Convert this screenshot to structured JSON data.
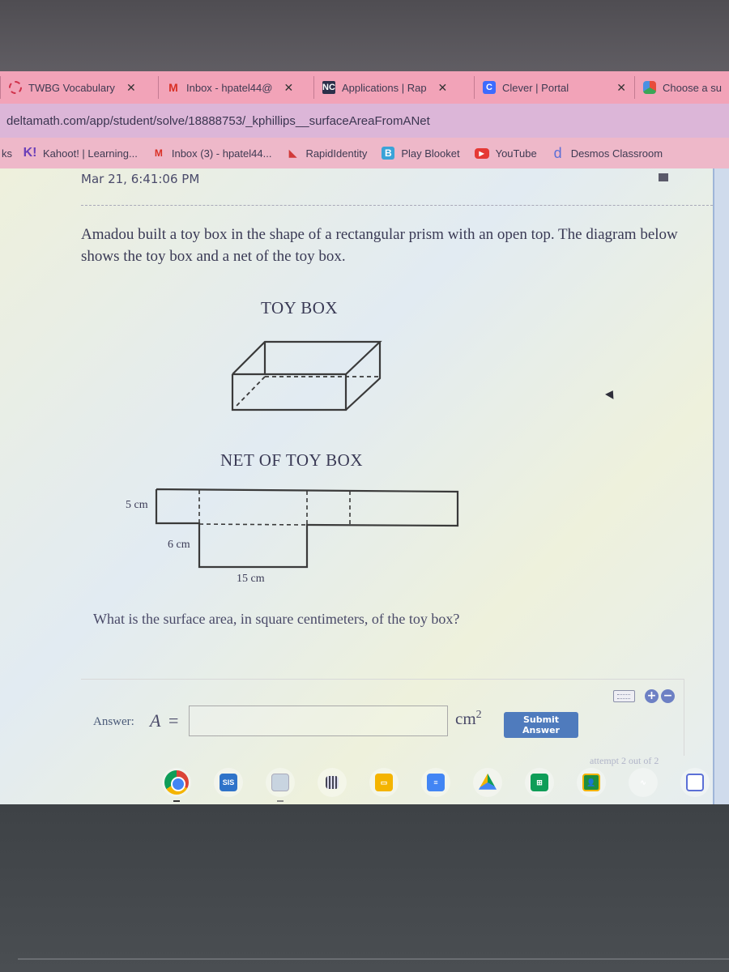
{
  "browser": {
    "tabs": [
      {
        "title": "TWBG Vocabulary",
        "icon": "loading-ring-icon",
        "closable": true
      },
      {
        "title": "Inbox - hpatel44@",
        "icon": "gmail-icon",
        "closable": true
      },
      {
        "title": "Applications | Rap",
        "icon": "nc-icon",
        "icon_text": "NC",
        "closable": true
      },
      {
        "title": "Clever | Portal",
        "icon": "clever-icon",
        "icon_text": "C",
        "closable": true
      },
      {
        "title": "Choose a su",
        "icon": "cube-icon",
        "closable": false
      }
    ],
    "url": "deltamath.com/app/student/solve/18888753/_kphillips__surfaceAreaFromANet",
    "bookmarks_prefix": "ks",
    "bookmarks": [
      {
        "label": "Kahoot! | Learning...",
        "icon": "kahoot-icon",
        "icon_text": "K!"
      },
      {
        "label": "Inbox (3) - hpatel44...",
        "icon": "gmail-icon",
        "icon_text": "M"
      },
      {
        "label": "RapidIdentity",
        "icon": "rapididentity-icon",
        "icon_text": "◣"
      },
      {
        "label": "Play Blooket",
        "icon": "blooket-icon",
        "icon_text": "B"
      },
      {
        "label": "YouTube",
        "icon": "youtube-icon",
        "icon_text": "▶"
      },
      {
        "label": "Desmos Classroom",
        "icon": "desmos-icon",
        "icon_text": "d"
      }
    ]
  },
  "page": {
    "timestamp": "Mar 21, 6:41:06 PM",
    "problem_text": "Amadou built a toy box in the shape of a rectangular prism with an open top. The diagram below shows the toy box and a net of the toy box.",
    "figure_title_box": "TOY BOX",
    "figure_title_net": "NET OF TOY BOX",
    "dimensions": {
      "height": "5 cm",
      "width": "6 cm",
      "length": "15 cm"
    },
    "question": "What is the surface area, in square centimeters, of the toy box?",
    "answer": {
      "label": "Answer:",
      "variable": "A",
      "equals": "=",
      "value": "",
      "unit": "cm",
      "unit_exponent": "2",
      "submit_label": "Submit Answer",
      "zoom_in_label": "+",
      "zoom_out_label": "−",
      "attempt_text": "attempt 2 out of 2"
    }
  },
  "shelf": {
    "apps": [
      {
        "name": "chrome",
        "label": ""
      },
      {
        "name": "sis",
        "label": "SIS"
      },
      {
        "name": "blank-app",
        "label": ""
      },
      {
        "name": "qr-app",
        "label": ""
      },
      {
        "name": "google-slides",
        "label": ""
      },
      {
        "name": "google-docs",
        "label": "≡"
      },
      {
        "name": "google-drive",
        "label": ""
      },
      {
        "name": "google-sheets",
        "label": "⊞"
      },
      {
        "name": "google-classroom",
        "label": ""
      },
      {
        "name": "wave-app",
        "label": "∿"
      },
      {
        "name": "other-app",
        "label": "◇"
      }
    ]
  }
}
